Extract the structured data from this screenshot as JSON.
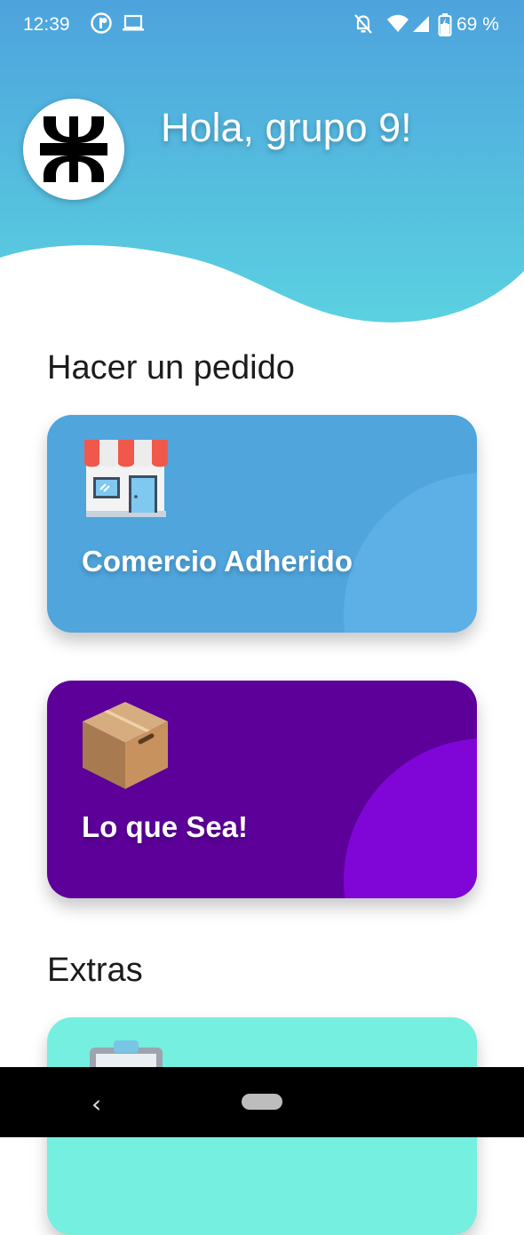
{
  "status_bar": {
    "time": "12:39",
    "battery_text": "69 %",
    "icons": [
      "app-notification-icon",
      "laptop-icon",
      "notifications-off-icon",
      "wifi-icon",
      "cell-signal-icon",
      "battery-charging-icon"
    ]
  },
  "header": {
    "greeting": "Hola, grupo 9!",
    "logo": "utn-logo",
    "gradient_top": "#4da3dd",
    "gradient_bottom": "#5bd1e0"
  },
  "sections": {
    "order_title": "Hacer un pedido",
    "extras_title": "Extras"
  },
  "cards": {
    "comercio": {
      "label": "Comercio Adherido",
      "icon": "store-icon",
      "color": "#4fa5dc"
    },
    "loquesea": {
      "label": "Lo que Sea!",
      "icon": "box-icon",
      "color": "#5c0099"
    },
    "extras": {
      "icon": "clipboard-icon",
      "color": "#75efdf"
    }
  },
  "nav": {
    "back_glyph": "‹"
  }
}
